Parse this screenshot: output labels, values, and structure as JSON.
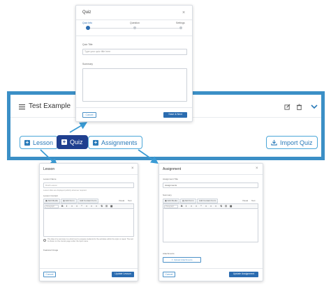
{
  "builder": {
    "course_title": "Test Example",
    "buttons": {
      "lesson": "Lesson",
      "quiz": "Quiz",
      "assignments": "Assignments",
      "import_quiz": "Import Quiz"
    }
  },
  "quiz_modal": {
    "title": "Quiz",
    "steps": [
      "Quiz Info",
      "Question",
      "Settings"
    ],
    "title_label": "Quiz Title",
    "title_placeholder": "Type your quiz title here",
    "summary_label": "Summary",
    "cancel": "Cancel",
    "save": "Save & Next"
  },
  "lesson_modal": {
    "title": "Lesson",
    "name_label": "Lesson Name",
    "name_value": "Draft Lesson",
    "name_help": "Lesson titles are displayed publicly wherever required.",
    "content_label": "Lesson Content",
    "media_buttons": [
      "Add Media",
      "Add Form",
      "Add Contact Form"
    ],
    "editor_tabs": [
      "Visual",
      "Text"
    ],
    "format_select": "Paragraph",
    "help_text": "The idea of a summary is a short text to prepare students for the activities within the topic or week. The text is shown on the course page under the topic name.",
    "feature_label": "Featured Image",
    "cancel": "Cancel",
    "update": "Update Lesson"
  },
  "assignment_modal": {
    "title": "Assignment",
    "title_label": "Assignment Title",
    "title_value": "Assignments",
    "summary_label": "Summary",
    "media_buttons": [
      "Add Media",
      "Add Form",
      "Add Contact Form"
    ],
    "editor_tabs": [
      "Visual",
      "Text"
    ],
    "format_select": "Paragraph",
    "attachments_label": "Attachments",
    "upload_button": "Upload Attachments",
    "cancel": "Cancel",
    "update": "Update Assignment"
  },
  "toolbar_glyphs": [
    "B",
    "I",
    "≡",
    "≡",
    "“",
    "≡",
    "≡",
    "≡",
    "⚗",
    "☰",
    "▦"
  ],
  "colors": {
    "frame": "#3b8fc6",
    "primary": "#2b6cb0",
    "quiz_active": "#1f3f8f",
    "chip_border": "#4aa6d8",
    "arrow": "#3a9bd5"
  }
}
